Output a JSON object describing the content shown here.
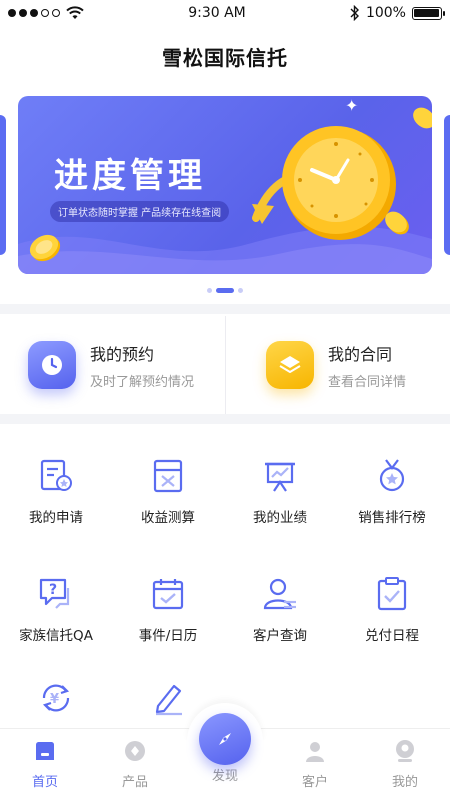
{
  "status_bar": {
    "time": "9:30 AM",
    "battery_percent": "100%",
    "battery_level": 1.0,
    "signal_bars_filled": 3,
    "signal_bars_total": 5
  },
  "header": {
    "title": "雪松国际信托"
  },
  "banner": {
    "title": "进度管理",
    "subtitle": "订单状态随时掌握  产品续存在线查阅",
    "slides_total": 3,
    "active_slide": 2,
    "colors": {
      "bg": "#5a63ea",
      "clock": "#ffc424"
    }
  },
  "quick_cards": [
    {
      "title": "我的预约",
      "subtitle": "及时了解预约情况",
      "icon": "clock-icon",
      "color": "#5b6cf2"
    },
    {
      "title": "我的合同",
      "subtitle": "查看合同详情",
      "icon": "layers-icon",
      "color": "#f7b500"
    }
  ],
  "grid_items": [
    {
      "label": "我的申请",
      "icon": "application-icon"
    },
    {
      "label": "收益测算",
      "icon": "calculator-icon"
    },
    {
      "label": "我的业绩",
      "icon": "presentation-chart-icon"
    },
    {
      "label": "销售排行榜",
      "icon": "medal-icon"
    },
    {
      "label": "家族信托QA",
      "icon": "question-chat-icon"
    },
    {
      "label": "事件/日历",
      "icon": "calendar-icon"
    },
    {
      "label": "客户查询",
      "icon": "user-search-icon"
    },
    {
      "label": "兑付日程",
      "icon": "clipboard-check-icon"
    },
    {
      "label": "",
      "icon": "yuan-refresh-icon"
    },
    {
      "label": "",
      "icon": "pencil-icon"
    }
  ],
  "tabbar": {
    "tabs": [
      {
        "label": "首页",
        "icon": "home-icon",
        "active": true
      },
      {
        "label": "产品",
        "icon": "product-icon",
        "active": false
      },
      {
        "label": "发现",
        "icon": "compass-icon",
        "active": false
      },
      {
        "label": "客户",
        "icon": "customer-icon",
        "active": false
      },
      {
        "label": "我的",
        "icon": "profile-icon",
        "active": false
      }
    ],
    "active_color": "#5a6cf0",
    "inactive_color": "#c8c8cc"
  }
}
